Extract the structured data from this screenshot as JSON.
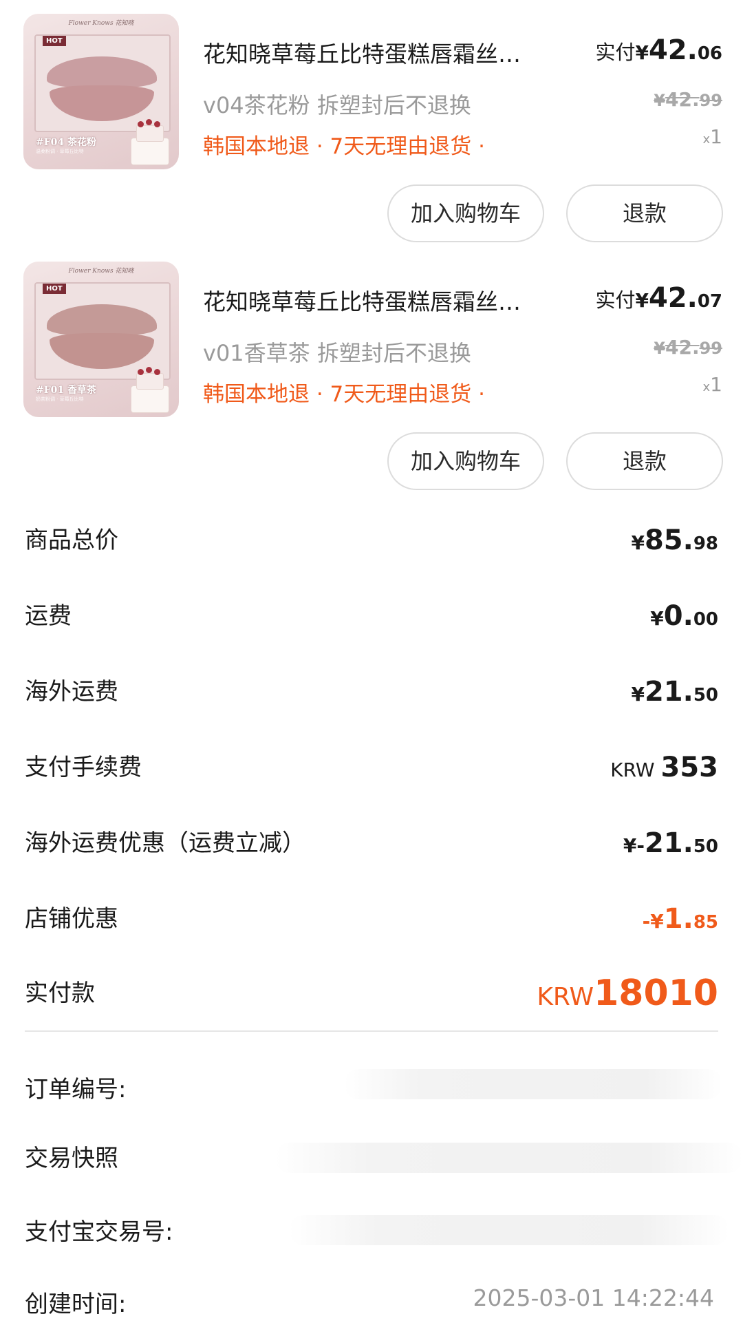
{
  "products": [
    {
      "title": "花知晓草莓丘比特蛋糕唇霜丝…",
      "variant": "v04茶花粉 拆塑封后不退换",
      "tags": "韩国本地退 · 7天无理由退货 ·",
      "paid_label": "实付",
      "paid_currency": "¥",
      "paid_int": "42.",
      "paid_dec": "06",
      "orig_currency": "¥",
      "orig_int": "42.",
      "orig_dec": "99",
      "qty_x": "x",
      "qty": "1",
      "image": {
        "brand": "Flower Knows 花知晓",
        "hot": "HOT",
        "shade": "#F04 茶花粉",
        "caption": "温柔粉调 · 草莓丘比特"
      },
      "add_to_cart_label": "加入购物车",
      "refund_label": "退款"
    },
    {
      "title": "花知晓草莓丘比特蛋糕唇霜丝…",
      "variant": "v01香草茶 拆塑封后不退换",
      "tags": "韩国本地退 · 7天无理由退货 ·",
      "paid_label": "实付",
      "paid_currency": "¥",
      "paid_int": "42.",
      "paid_dec": "07",
      "orig_currency": "¥",
      "orig_int": "42.",
      "orig_dec": "99",
      "qty_x": "x",
      "qty": "1",
      "image": {
        "brand": "Flower Knows 花知晓",
        "hot": "HOT",
        "shade": "#F01 香草茶",
        "caption": "奶茶粉调 · 草莓丘比特"
      },
      "add_to_cart_label": "加入购物车",
      "refund_label": "退款"
    }
  ],
  "summary": [
    {
      "label": "商品总价",
      "currency": "¥",
      "int": "85.",
      "dec": "98"
    },
    {
      "label": "运费",
      "currency": "¥",
      "int": "0.",
      "dec": "00"
    },
    {
      "label": "海外运费",
      "currency": "¥",
      "int": "21.",
      "dec": "50"
    },
    {
      "label": "支付手续费",
      "currency": "KRW ",
      "int": "353",
      "dec": ""
    },
    {
      "label": "海外运费优惠（运费立减）",
      "currency": "¥-",
      "int": "21.",
      "dec": "50"
    },
    {
      "label": "店铺优惠",
      "currency": "-¥",
      "int": "1.",
      "dec": "85"
    },
    {
      "label": "实付款",
      "currency": "KRW",
      "int": "18010",
      "dec": ""
    }
  ],
  "order_info": {
    "order_no_label": "订单编号:",
    "snapshot_label": "交易快照",
    "alipay_label": "支付宝交易号:",
    "created_label": "创建时间:",
    "created_value": "2025-03-01 14:22:44"
  },
  "colors": {
    "accent": "#f05a1a",
    "text": "#1a1a1a",
    "muted": "#9a9a9a",
    "border": "#dcdcdc"
  }
}
